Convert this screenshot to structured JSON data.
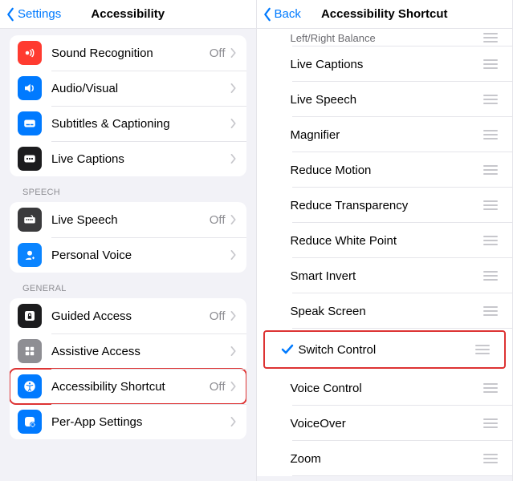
{
  "left": {
    "back_label": "Settings",
    "title": "Accessibility",
    "groups": [
      {
        "header": null,
        "rows": [
          {
            "id": "sound-recognition",
            "label": "Sound Recognition",
            "status": "Off",
            "icon": "sound",
            "bg": "bg-pink"
          },
          {
            "id": "audio-visual",
            "label": "Audio/Visual",
            "status": null,
            "icon": "speaker",
            "bg": "bg-blue"
          },
          {
            "id": "subtitles",
            "label": "Subtitles & Captioning",
            "status": null,
            "icon": "caption",
            "bg": "bg-blue"
          },
          {
            "id": "live-captions",
            "label": "Live Captions",
            "status": null,
            "icon": "livecap",
            "bg": "bg-black"
          }
        ]
      },
      {
        "header": "SPEECH",
        "rows": [
          {
            "id": "live-speech",
            "label": "Live Speech",
            "status": "Off",
            "icon": "keyboard",
            "bg": "bg-darkgray"
          },
          {
            "id": "personal-voice",
            "label": "Personal Voice",
            "status": null,
            "icon": "person",
            "bg": "bg-blue2"
          }
        ]
      },
      {
        "header": "GENERAL",
        "rows": [
          {
            "id": "guided-access",
            "label": "Guided Access",
            "status": "Off",
            "icon": "lock",
            "bg": "bg-lock"
          },
          {
            "id": "assistive-access",
            "label": "Assistive Access",
            "status": null,
            "icon": "grid",
            "bg": "bg-gray"
          },
          {
            "id": "accessibility-shortcut",
            "label": "Accessibility Shortcut",
            "status": "Off",
            "icon": "access",
            "bg": "bg-blue",
            "highlight": true
          },
          {
            "id": "per-app",
            "label": "Per-App Settings",
            "status": null,
            "icon": "perapp",
            "bg": "bg-blue"
          }
        ]
      }
    ]
  },
  "right": {
    "back_label": "Back",
    "title": "Accessibility Shortcut",
    "partial_top": "Left/Right Balance",
    "items": [
      {
        "id": "live-captions",
        "label": "Live Captions"
      },
      {
        "id": "live-speech",
        "label": "Live Speech"
      },
      {
        "id": "magnifier",
        "label": "Magnifier"
      },
      {
        "id": "reduce-motion",
        "label": "Reduce Motion"
      },
      {
        "id": "reduce-transparency",
        "label": "Reduce Transparency"
      },
      {
        "id": "reduce-white-point",
        "label": "Reduce White Point"
      },
      {
        "id": "smart-invert",
        "label": "Smart Invert"
      },
      {
        "id": "speak-screen",
        "label": "Speak Screen"
      },
      {
        "id": "switch-control",
        "label": "Switch Control",
        "checked": true,
        "highlight": true
      },
      {
        "id": "voice-control",
        "label": "Voice Control"
      },
      {
        "id": "voiceover",
        "label": "VoiceOver"
      },
      {
        "id": "zoom",
        "label": "Zoom"
      }
    ]
  }
}
